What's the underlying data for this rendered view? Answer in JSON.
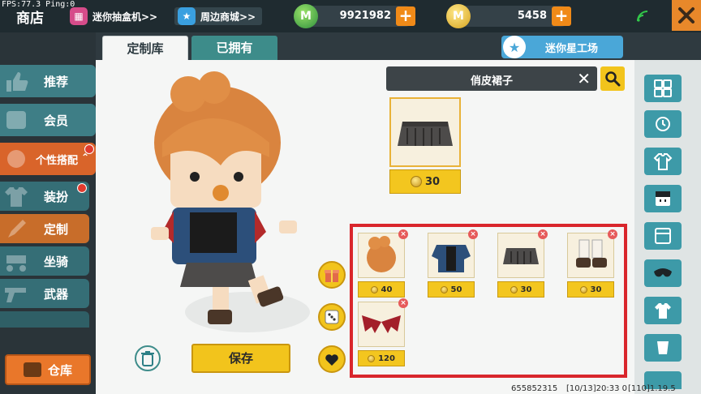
{
  "hud": {
    "fps": "FPS:77.3  Ping:0"
  },
  "header": {
    "title": "商店",
    "link_blindbox": "迷你抽盒机>>",
    "link_merch": "周边商城>>",
    "currency_green": "9921982",
    "currency_gold": "5458",
    "coin_green_letter": "M",
    "coin_gold_letter": "M"
  },
  "sidebar": {
    "items": [
      {
        "label": "推荐"
      },
      {
        "label": "会员"
      },
      {
        "label": "个性搭配"
      },
      {
        "label": "装扮"
      },
      {
        "label": "定制"
      },
      {
        "label": "坐骑"
      },
      {
        "label": "武器"
      }
    ],
    "storage": "仓库"
  },
  "tabs": {
    "custom": "定制库",
    "owned": "已拥有"
  },
  "workshop": {
    "label": "迷你星工场"
  },
  "search": {
    "value": "俏皮裙子"
  },
  "result": {
    "price": "30"
  },
  "outfit": {
    "items": [
      {
        "name": "hair",
        "price": "40"
      },
      {
        "name": "jacket",
        "price": "50"
      },
      {
        "name": "skirt",
        "price": "30"
      },
      {
        "name": "shoes",
        "price": "30"
      },
      {
        "name": "wings",
        "price": "120"
      }
    ]
  },
  "save_button": "保存",
  "footer": {
    "id": "655852315",
    "time": "[10/13]20:33 0",
    "version": "[110]1.19.5"
  },
  "colors": {
    "accent": "#d9642a",
    "teal": "#3e7e86",
    "gold": "#f2c41c",
    "highlight": "#d9262c"
  }
}
